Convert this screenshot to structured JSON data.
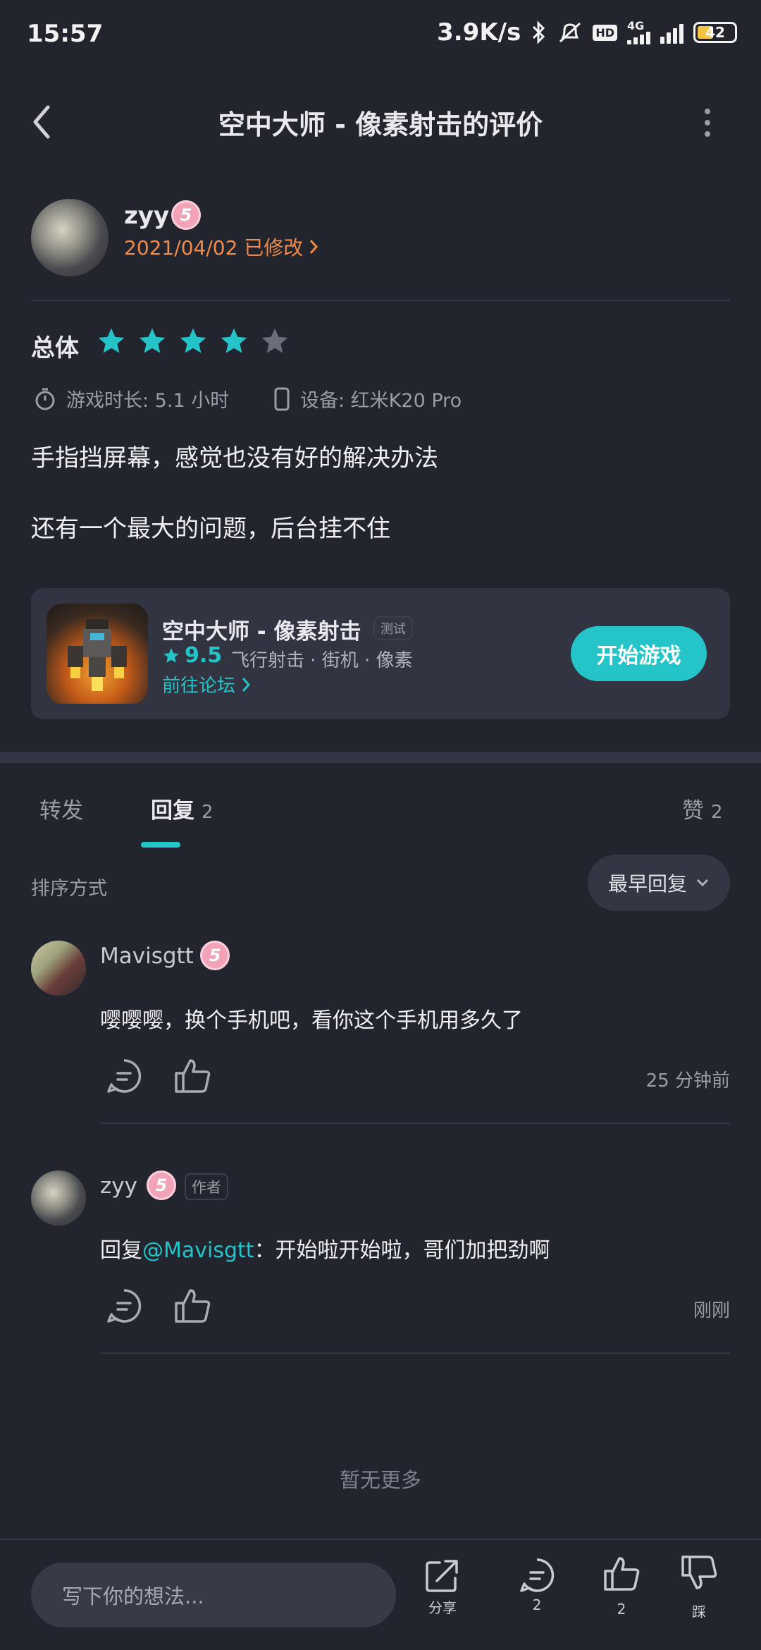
{
  "status_bar": {
    "time": "15:57",
    "speed": "3.9K/s",
    "hd": "HD",
    "network": "4G",
    "battery": "42"
  },
  "header": {
    "title": "空中大师 - 像素射击的评价"
  },
  "review": {
    "author": "zyy",
    "level": "5",
    "date_line": "2021/04/02 已修改",
    "overall_label": "总体",
    "rating": 4,
    "max_rating": 5,
    "play_time": "游戏时长: 5.1 小时",
    "device": "设备: 红米K20 Pro",
    "body_line1": "手指挡屏幕，感觉也没有好的解决办法",
    "body_line2": "还有一个最大的问题，后台挂不住"
  },
  "game_card": {
    "name": "空中大师 - 像素射击",
    "tag": "测试",
    "score": "9.5",
    "genres": "飞行射击 · 街机 · 像素",
    "forum_link": "前往论坛",
    "play_button": "开始游戏"
  },
  "tabs": {
    "forward": "转发",
    "replies": "回复",
    "replies_count": "2",
    "likes": "赞",
    "likes_count": "2"
  },
  "sort": {
    "label": "排序方式",
    "selected": "最早回复"
  },
  "replies": [
    {
      "author": "Mavisgtt",
      "level": "5",
      "text": "嘤嘤嘤，换个手机吧，看你这个手机用多久了",
      "time": "25 分钟前"
    },
    {
      "author": "zyy",
      "level": "5",
      "author_tag": "作者",
      "text_prefix": "回复",
      "mention": "@Mavisgtt",
      "text_suffix": "：开始啦开始啦，哥们加把劲啊",
      "time": "刚刚"
    }
  ],
  "no_more": "暂无更多",
  "bottom_bar": {
    "input_placeholder": "写下你的想法...",
    "share_label": "分享",
    "comment_count": "2",
    "like_count": "2",
    "dislike_label": "踩"
  },
  "colors": {
    "accent": "#24c4c8",
    "date_orange": "#f08a4b",
    "background": "#23252e",
    "card": "#323541"
  }
}
